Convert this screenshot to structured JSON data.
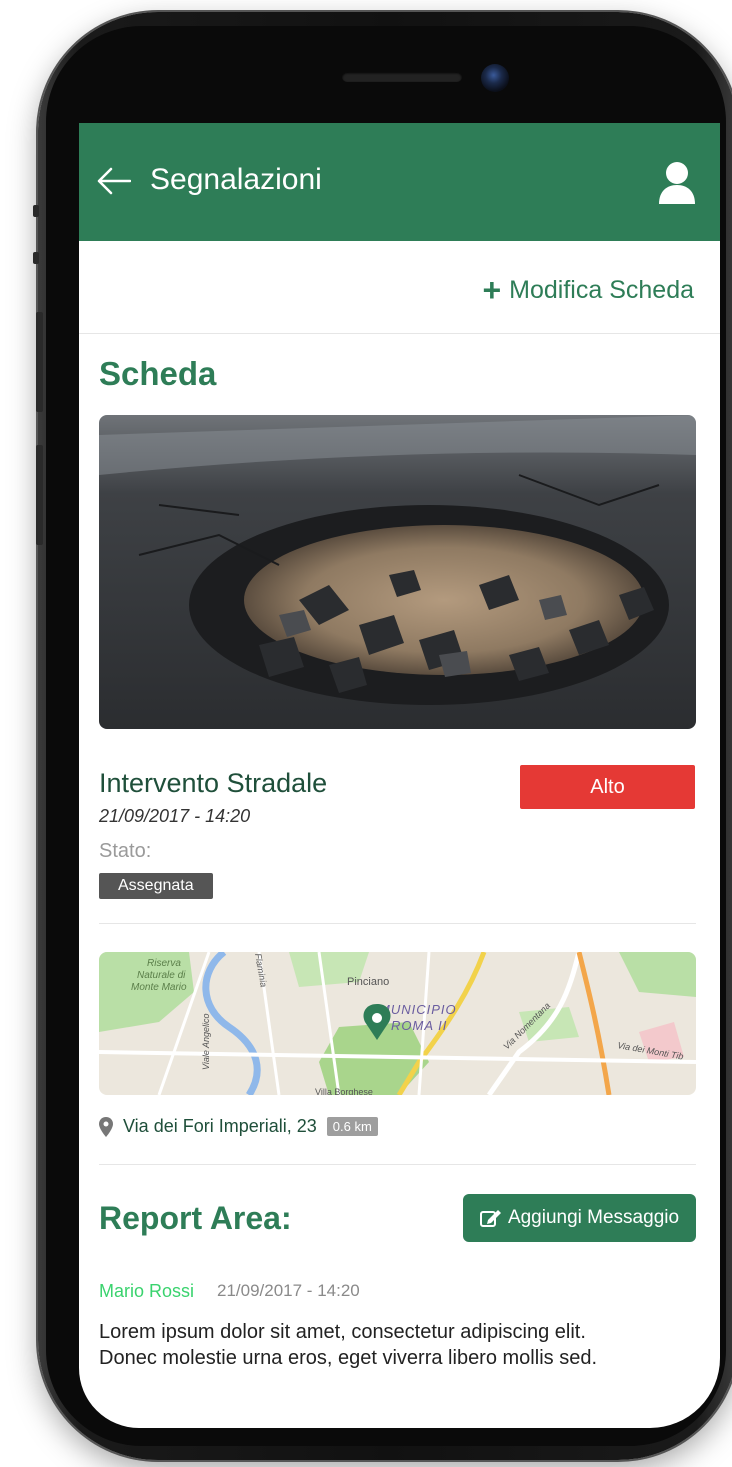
{
  "header": {
    "title": "Segnalazioni"
  },
  "actions": {
    "edit_label": "Modifica Scheda"
  },
  "scheda": {
    "section_title": "Scheda",
    "intervention_title": "Intervento Stradale",
    "datetime": "21/09/2017 - 14:20",
    "status_label": "Stato:",
    "status_value": "Assegnata",
    "priority": "Alto"
  },
  "map": {
    "labels": [
      "Riserva",
      "Naturale di",
      "Monte Mario",
      "Pinciano",
      "MUNICIPIO",
      "ROMA II",
      "Villa Borghese",
      "Viale Angelico",
      "Flaminia",
      "Via Nomentana",
      "Via dei Monti Tib"
    ],
    "address": "Via dei Fori Imperiali, 23",
    "distance": "0.6 km"
  },
  "report": {
    "title": "Report Area:",
    "add_button_label": "Aggiungi Messaggio",
    "messages": [
      {
        "author": "Mario Rossi",
        "datetime": "21/09/2017 - 14:20",
        "text": "Lorem ipsum dolor sit amet, consectetur adipiscing elit. Donec molestie urna eros, eget viverra libero mollis sed."
      }
    ]
  },
  "colors": {
    "primary": "#2e7d57",
    "priority_high": "#e53935",
    "author": "#3ad36e"
  },
  "icons": {
    "back": "arrow-left-icon",
    "user": "user-icon",
    "plus": "plus-icon",
    "location": "map-pin-icon",
    "edit": "edit-icon"
  }
}
